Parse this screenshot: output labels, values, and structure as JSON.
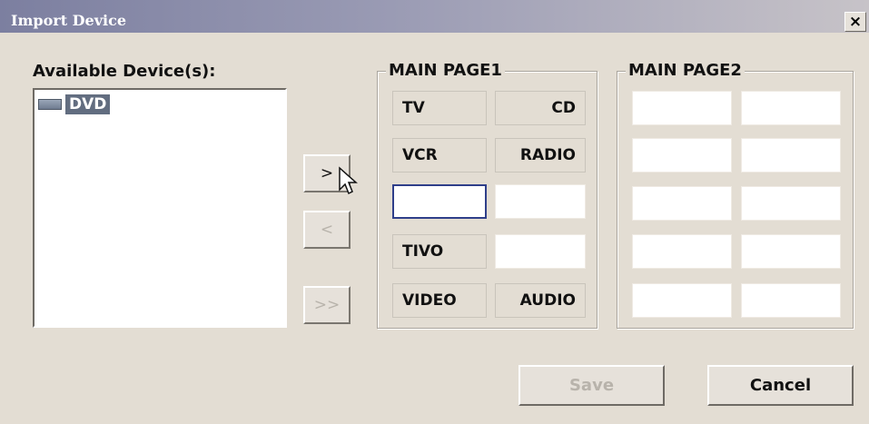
{
  "window": {
    "title": "Import Device",
    "close_label": "×"
  },
  "available": {
    "label": "Available Device(s):",
    "items": [
      {
        "label": "DVD",
        "icon": "device-icon"
      }
    ]
  },
  "move_buttons": {
    "add": ">",
    "remove": "<",
    "add_all": ">>"
  },
  "main_page1": {
    "title": "MAIN PAGE1",
    "slots": [
      {
        "label": "TV",
        "align": "left"
      },
      {
        "label": "CD",
        "align": "right"
      },
      {
        "label": "VCR",
        "align": "left"
      },
      {
        "label": "RADIO",
        "align": "right"
      },
      {
        "label": "",
        "selected": true
      },
      {
        "label": ""
      },
      {
        "label": "TIVO",
        "align": "left"
      },
      {
        "label": ""
      },
      {
        "label": "VIDEO",
        "align": "left"
      },
      {
        "label": "AUDIO",
        "align": "right"
      }
    ]
  },
  "main_page2": {
    "title": "MAIN PAGE2",
    "slots": [
      "",
      "",
      "",
      "",
      "",
      "",
      "",
      "",
      "",
      ""
    ]
  },
  "actions": {
    "save": "Save",
    "cancel": "Cancel"
  },
  "colors": {
    "title_bar": "#7c7fa0",
    "selection": "#626d80",
    "slot_focus": "#2f3f8a"
  }
}
